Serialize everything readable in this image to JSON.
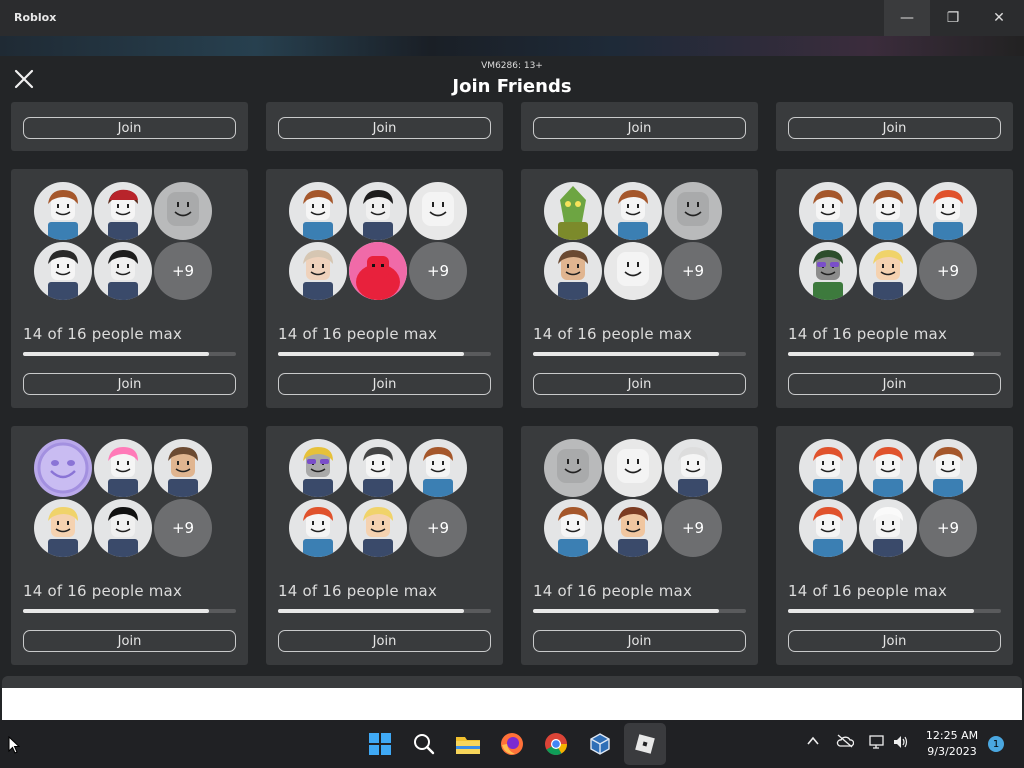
{
  "window": {
    "title": "Roblox",
    "minimize_glyph": "—",
    "maximize_glyph": "❐",
    "close_glyph": "✕"
  },
  "modal": {
    "server_label": "VM6286: 13+",
    "title": "Join Friends",
    "join_label": "Join",
    "people_label": "14 of 16 people max",
    "fill_fraction": 0.875,
    "overflow_label": "+9"
  },
  "cards": [
    {
      "avatars": [
        "noob-brown",
        "noob-redcap",
        "blank-gray",
        "mini-figure",
        "dark-hair-girl"
      ]
    },
    {
      "avatars": [
        "noob-brown",
        "dark-hair-girl",
        "blank-white",
        "old-granny",
        "red-blob"
      ]
    },
    {
      "avatars": [
        "green-lizard",
        "noob-brown",
        "blank-gray",
        "brown-hair-man",
        "blank-white"
      ]
    },
    {
      "avatars": [
        "noob-brown",
        "noob-brown",
        "red-hair-girl",
        "purple-glasses",
        "blonde-girl"
      ]
    },
    {
      "avatars": [
        "purple-smile",
        "pink-anime",
        "brown-hair-man",
        "blonde-girl",
        "black-hair"
      ]
    },
    {
      "avatars": [
        "blonde-glasses",
        "bike-rider",
        "noob-brown",
        "red-hair-girl",
        "blonde-girl"
      ]
    },
    {
      "avatars": [
        "blank-gray",
        "blank-white",
        "bald-ninja",
        "noob-brown",
        "spiky-brown"
      ]
    },
    {
      "avatars": [
        "red-hair-girl",
        "red-hair-girl",
        "noob-brown",
        "red-hair-girl",
        "white-figure"
      ]
    }
  ],
  "taskbar": {
    "icons": [
      "windows-start-icon",
      "search-icon",
      "file-explorer-icon",
      "firefox-icon",
      "chrome-icon",
      "virtualbox-icon",
      "roblox-icon"
    ],
    "clock_time": "12:25 AM",
    "clock_date": "9/3/2023",
    "notification_count": "1"
  },
  "colors": {
    "modal_bg": "#232527",
    "card_bg": "#393b3d",
    "taskbar_bg": "#202124"
  }
}
